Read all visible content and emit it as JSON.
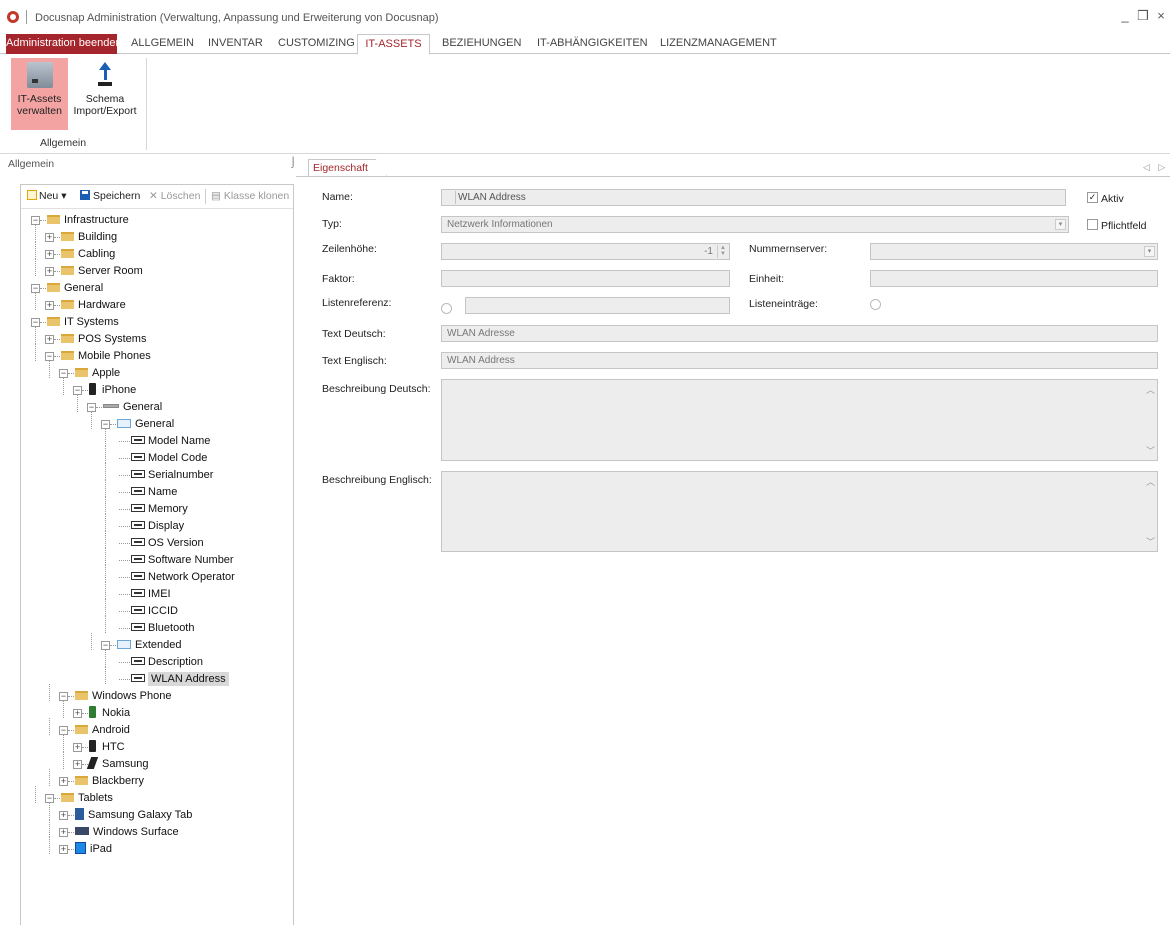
{
  "window": {
    "title": "Docusnap Administration (Verwaltung, Anpassung und Erweiterung von Docusnap)",
    "minimize": "_",
    "restore": "❒",
    "close": "×"
  },
  "ribbon": {
    "exit_label": "Administration beenden",
    "tabs": [
      "ALLGEMEIN",
      "INVENTAR",
      "CUSTOMIZING",
      "IT-ASSETS",
      "BEZIEHUNGEN",
      "IT-ABHÄNGIGKEITEN",
      "LIZENZMANAGEMENT"
    ],
    "active_tab": "IT-ASSETS",
    "buttons": [
      {
        "label1": "IT-Assets",
        "label2": "verwalten",
        "icon": "drive-icon",
        "selected": true
      },
      {
        "label1": "Schema",
        "label2": "Import/Export",
        "icon": "upload-icon",
        "selected": false
      }
    ],
    "group_label": "Allgemein"
  },
  "left": {
    "header": "Allgemein",
    "pin": "⌡",
    "toolbar": {
      "new": "Neu",
      "new_caret": "▾",
      "save": "Speichern",
      "delete": "Löschen",
      "clone": "Klasse klonen"
    },
    "tree": [
      {
        "label": "Infrastructure",
        "icon": "folder"
      },
      {
        "label": "Building",
        "icon": "folder"
      },
      {
        "label": "Cabling",
        "icon": "folder"
      },
      {
        "label": "Server Room",
        "icon": "folder"
      },
      {
        "label": "General",
        "icon": "folder"
      },
      {
        "label": "Hardware",
        "icon": "folder"
      },
      {
        "label": "IT Systems",
        "icon": "folder"
      },
      {
        "label": "POS Systems",
        "icon": "folder"
      },
      {
        "label": "Mobile Phones",
        "icon": "folder"
      },
      {
        "label": "Apple",
        "icon": "folder"
      },
      {
        "label": "iPhone",
        "icon": "phone"
      },
      {
        "label": "General",
        "icon": "bar"
      },
      {
        "label": "General",
        "icon": "group"
      },
      {
        "label": "Model Name",
        "icon": "abl"
      },
      {
        "label": "Model Code",
        "icon": "abl"
      },
      {
        "label": "Serialnumber",
        "icon": "abl"
      },
      {
        "label": "Name",
        "icon": "abl"
      },
      {
        "label": "Memory",
        "icon": "abl"
      },
      {
        "label": "Display",
        "icon": "abl"
      },
      {
        "label": "OS Version",
        "icon": "abl"
      },
      {
        "label": "Software Number",
        "icon": "abl"
      },
      {
        "label": "Network Operator",
        "icon": "abl"
      },
      {
        "label": "IMEI",
        "icon": "abl"
      },
      {
        "label": "ICCID",
        "icon": "abl"
      },
      {
        "label": "Bluetooth",
        "icon": "abl"
      },
      {
        "label": "Extended",
        "icon": "group"
      },
      {
        "label": "Description",
        "icon": "abl"
      },
      {
        "label": "WLAN Address",
        "icon": "abl",
        "selected": true
      },
      {
        "label": "Windows Phone",
        "icon": "folder"
      },
      {
        "label": "Nokia",
        "icon": "nokia"
      },
      {
        "label": "Android",
        "icon": "folder"
      },
      {
        "label": "HTC",
        "icon": "phone"
      },
      {
        "label": "Samsung",
        "icon": "samsung"
      },
      {
        "label": "Blackberry",
        "icon": "folder"
      },
      {
        "label": "Tablets",
        "icon": "folder"
      },
      {
        "label": "Samsung Galaxy Tab",
        "icon": "tab"
      },
      {
        "label": "Windows Surface",
        "icon": "surface"
      },
      {
        "label": "iPad",
        "icon": "ipad"
      }
    ]
  },
  "right": {
    "doc_tab": "Eigenschaft",
    "nav_arrows": "◁ ▷",
    "form": {
      "name_label": "Name:",
      "name_value": "WLAN Address",
      "aktiv_label": "Aktiv",
      "aktiv_checked": true,
      "typ_label": "Typ:",
      "typ_value": "Netzwerk Informationen",
      "pflichtfeld_label": "Pflichtfeld",
      "pflichtfeld_checked": false,
      "zeilenhoehe_label": "Zeilenhöhe:",
      "zeilenhoehe_value": "-1",
      "nummernserver_label": "Nummernserver:",
      "nummernserver_value": "",
      "faktor_label": "Faktor:",
      "faktor_value": "",
      "einheit_label": "Einheit:",
      "einheit_value": "",
      "listenreferenz_label": "Listenreferenz:",
      "listenreferenz_value": "",
      "listeneintraege_label": "Listeneinträge:",
      "text_deutsch_label": "Text Deutsch:",
      "text_deutsch_value": "WLAN Adresse",
      "text_englisch_label": "Text Englisch:",
      "text_englisch_value": "WLAN Address",
      "beschreibung_deutsch_label": "Beschreibung Deutsch:",
      "beschreibung_deutsch_value": "",
      "beschreibung_englisch_label": "Beschreibung Englisch:",
      "beschreibung_englisch_value": ""
    }
  },
  "colors": {
    "accent": "#a4262c",
    "selected_ribbon_button": "#f4a3a3",
    "field_bg": "#ededed"
  }
}
